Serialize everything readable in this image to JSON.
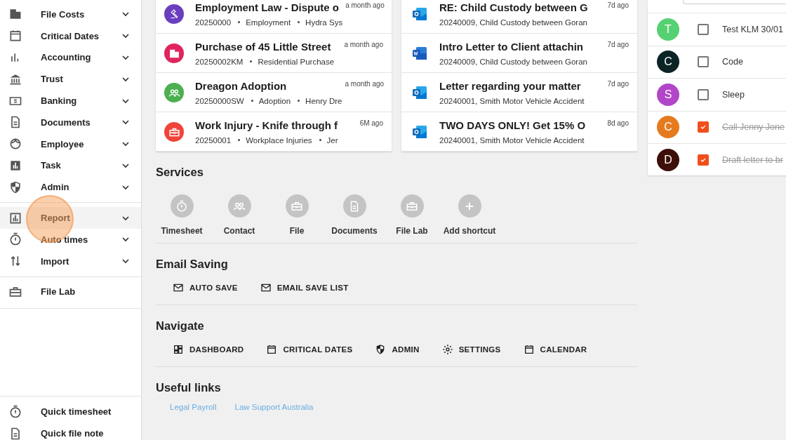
{
  "sidebar": {
    "items": [
      {
        "label": "File Costs",
        "expandable": true,
        "selected": false
      },
      {
        "label": "Critical Dates",
        "expandable": true,
        "selected": false
      },
      {
        "label": "Accounting",
        "expandable": true,
        "selected": false
      },
      {
        "label": "Trust",
        "expandable": true,
        "selected": false
      },
      {
        "label": "Banking",
        "expandable": true,
        "selected": false
      },
      {
        "label": "Documents",
        "expandable": true,
        "selected": false
      },
      {
        "label": "Employee",
        "expandable": true,
        "selected": false
      },
      {
        "label": "Task",
        "expandable": true,
        "selected": false
      },
      {
        "label": "Admin",
        "expandable": true,
        "selected": false
      }
    ],
    "reports": [
      {
        "label": "Report",
        "expandable": true,
        "selected": true
      },
      {
        "label": "Auto times",
        "expandable": true,
        "selected": false
      },
      {
        "label": "Import",
        "expandable": true,
        "selected": false
      }
    ],
    "labs": [
      {
        "label": "File Lab",
        "expandable": false,
        "selected": false
      }
    ],
    "quick": [
      {
        "label": "Quick timesheet"
      },
      {
        "label": "Quick file note"
      }
    ]
  },
  "matters": [
    {
      "title": "Employment Law - Dispute o",
      "time": "a month ago",
      "color": "#6a3fbf",
      "meta": [
        "20250000",
        "Employment",
        "Hydra Sys"
      ]
    },
    {
      "title": "Purchase of 45 Little Street",
      "time": "a month ago",
      "color": "#e0245e",
      "meta": [
        "20250002KM",
        "Residential Purchase"
      ]
    },
    {
      "title": "Dreagon Adoption",
      "time": "a month ago",
      "color": "#4caf50",
      "meta": [
        "20250000SW",
        "Adoption",
        "Henry Dre"
      ]
    },
    {
      "title": "Work Injury - Knife through f",
      "time": "6M ago",
      "color": "#f0443a",
      "meta": [
        "20250001",
        "Workplace Injuries",
        "Jer"
      ]
    }
  ],
  "documents": [
    {
      "kind": "email",
      "title": "RE: Child Custody between G",
      "subtitle": "20240009, Child Custody between Goran",
      "time": "7d ago"
    },
    {
      "kind": "word",
      "title": "Intro Letter to Client attachin",
      "subtitle": "20240009, Child Custody between Goran",
      "time": "7d ago"
    },
    {
      "kind": "email",
      "title": "Letter regarding your matter",
      "subtitle": "20240001, Smith Motor Vehicle Accident",
      "time": "7d ago"
    },
    {
      "kind": "email",
      "title": "TWO DAYS ONLY! Get 15% O",
      "subtitle": "20240001, Smith Motor Vehicle Accident",
      "time": "8d ago"
    }
  ],
  "tasks": [
    {
      "initial": "T",
      "color": "#55d172",
      "label": "Test KLM 30/01",
      "checked": false
    },
    {
      "initial": "C",
      "color": "#0d2426",
      "label": "Code",
      "checked": false
    },
    {
      "initial": "S",
      "color": "#b246c8",
      "label": "Sleep",
      "checked": false
    },
    {
      "initial": "C",
      "color": "#e67a1e",
      "label": "Call Jenny Jone",
      "checked": true
    },
    {
      "initial": "D",
      "color": "#3d0f08",
      "label": "Draft letter to br",
      "checked": true
    }
  ],
  "services": {
    "title": "Services",
    "items": [
      {
        "label": "Timesheet"
      },
      {
        "label": "Contact"
      },
      {
        "label": "File"
      },
      {
        "label": "Documents"
      },
      {
        "label": "File Lab"
      },
      {
        "label": "Add shortcut"
      }
    ]
  },
  "email_saving": {
    "title": "Email Saving",
    "buttons": [
      {
        "label": "AUTO SAVE"
      },
      {
        "label": "EMAIL SAVE LIST"
      }
    ]
  },
  "navigate": {
    "title": "Navigate",
    "buttons": [
      {
        "label": "DASHBOARD"
      },
      {
        "label": "CRITICAL DATES"
      },
      {
        "label": "ADMIN"
      },
      {
        "label": "SETTINGS"
      },
      {
        "label": "CALENDAR"
      }
    ]
  },
  "useful_links": {
    "title": "Useful links",
    "links": [
      {
        "label": "Legal Payroll"
      },
      {
        "label": "Law Support Australia"
      }
    ]
  }
}
